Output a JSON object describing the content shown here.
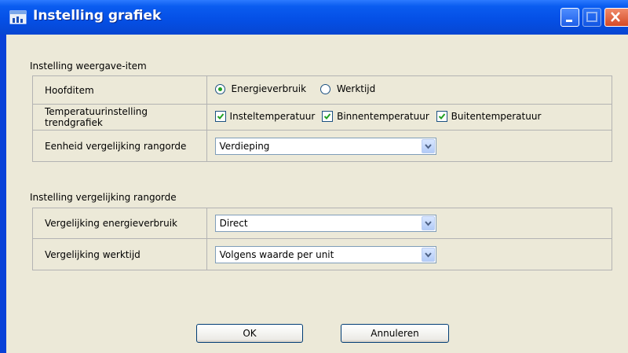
{
  "window": {
    "title": "Instelling grafiek"
  },
  "section1": {
    "heading": "Instelling weergave-item",
    "rows": [
      {
        "label": "Hoofditem",
        "options": [
          {
            "label": "Energieverbruik",
            "selected": true
          },
          {
            "label": "Werktijd",
            "selected": false
          }
        ]
      },
      {
        "label": "Temperatuurinstelling trendgrafiek",
        "checks": [
          {
            "label": "Insteltemperatuur",
            "checked": true
          },
          {
            "label": "Binnentemperatuur",
            "checked": true
          },
          {
            "label": "Buitentemperatuur",
            "checked": true
          }
        ]
      },
      {
        "label": "Eenheid vergelijking rangorde",
        "select_value": "Verdieping"
      }
    ]
  },
  "section2": {
    "heading": "Instelling vergelijking rangorde",
    "rows": [
      {
        "label": "Vergelijking energieverbruik",
        "select_value": "Direct"
      },
      {
        "label": "Vergelijking werktijd",
        "select_value": "Volgens waarde per unit"
      }
    ]
  },
  "buttons": {
    "ok": "OK",
    "cancel": "Annuleren"
  },
  "icons": {
    "app": "chart-window-icon",
    "minimize": "minimize-icon",
    "maximize": "maximize-icon",
    "close": "close-icon",
    "dropdown": "chevron-down-icon",
    "check": "check-icon"
  },
  "colors": {
    "titlebar": "#0550e6",
    "dialog_bg": "#ece9d8",
    "radio_dot": "#21a121",
    "close_button": "#d44a26"
  }
}
